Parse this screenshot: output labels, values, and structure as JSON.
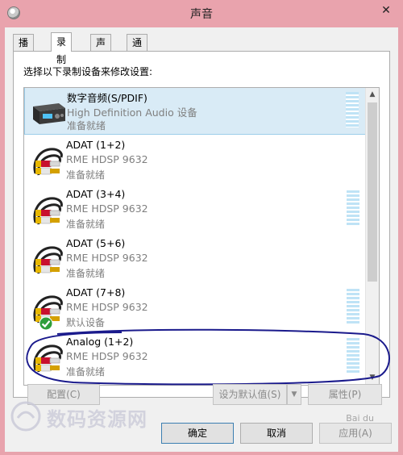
{
  "window": {
    "title": "声音",
    "close_label": "✕"
  },
  "tabs": [
    {
      "label": "播放"
    },
    {
      "label": "录制"
    },
    {
      "label": "声音"
    },
    {
      "label": "通信"
    }
  ],
  "instruction": "选择以下录制设备来修改设置:",
  "devices": [
    {
      "name": "数字音频(S/PDIF)",
      "description": "High Definition Audio 设备",
      "status": "准备就绪",
      "icon": "spdif-device-icon",
      "meter_visible": true,
      "default": false
    },
    {
      "name": "ADAT (1+2)",
      "description": "RME HDSP 9632",
      "status": "准备就绪",
      "icon": "rca-cable-icon",
      "meter_visible": false,
      "default": false
    },
    {
      "name": "ADAT (3+4)",
      "description": "RME HDSP 9632",
      "status": "准备就绪",
      "icon": "rca-cable-icon",
      "meter_visible": true,
      "default": false
    },
    {
      "name": "ADAT (5+6)",
      "description": "RME HDSP 9632",
      "status": "准备就绪",
      "icon": "rca-cable-icon",
      "meter_visible": false,
      "default": false
    },
    {
      "name": "ADAT (7+8)",
      "description": "RME HDSP 9632",
      "status": "默认设备",
      "icon": "rca-cable-icon",
      "meter_visible": true,
      "default": true
    },
    {
      "name": "Analog (1+2)",
      "description": "RME HDSP 9632",
      "status": "准备就绪",
      "icon": "rca-cable-icon",
      "meter_visible": true,
      "default": false
    }
  ],
  "buttons": {
    "configure": "配置(C)",
    "set_default": "设为默认值(S)",
    "properties": "属性(P)",
    "ok": "确定",
    "cancel": "取消",
    "apply": "应用(A)"
  },
  "watermark": {
    "text": "数码资源网",
    "corner_mark": "Bai du"
  },
  "colors": {
    "title_bar": "#e9a3ad",
    "selection": "#d9ebf6",
    "meter": "#bfe3f6",
    "annotation": "#1a1a8c",
    "default_check": "#2e9e3a"
  }
}
